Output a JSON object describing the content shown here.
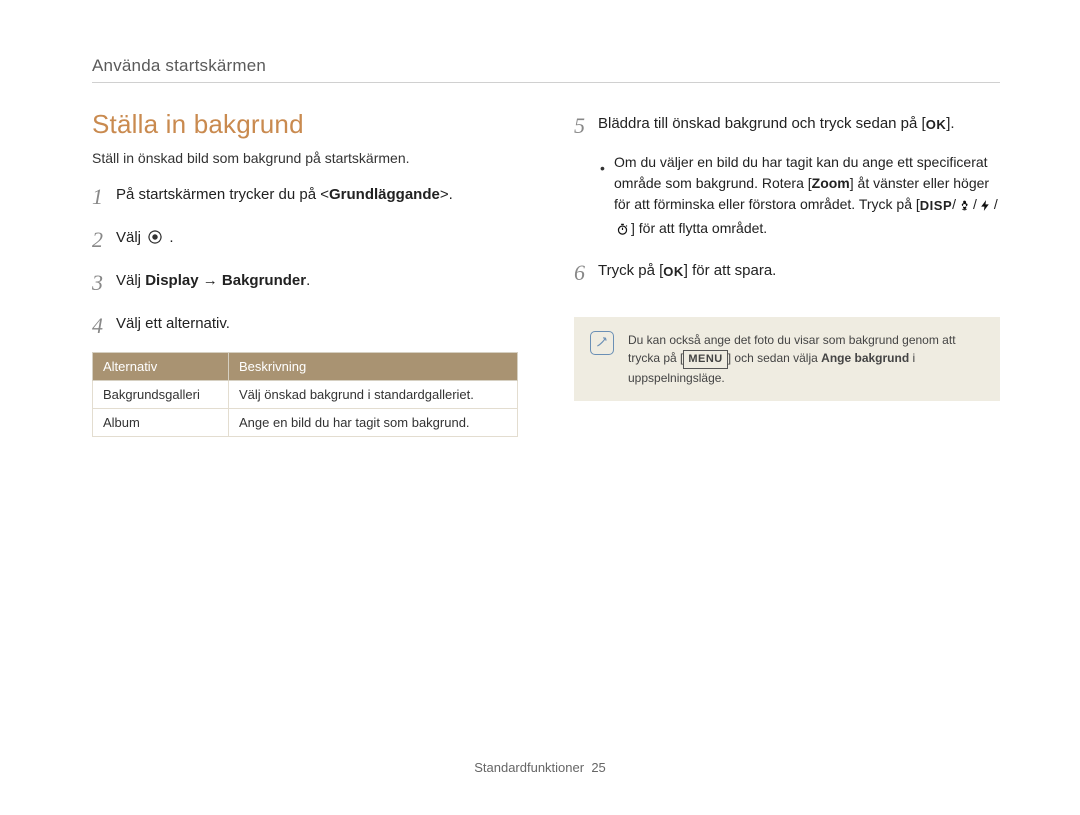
{
  "header": {
    "breadcrumb": "Använda startskärmen"
  },
  "left": {
    "title": "Ställa in bakgrund",
    "intro": "Ställ in önskad bild som bakgrund på startskärmen.",
    "step1_pre": "På startskärmen trycker du på <",
    "step1_bold": "Grundläggande",
    "step1_post": ">.",
    "step2_pre": "Välj ",
    "step2_post": ".",
    "step3_pre": "Välj ",
    "step3_bold1": "Display",
    "step3_arrow": " → ",
    "step3_bold2": "Bakgrunder",
    "step3_post": ".",
    "step4": "Välj ett alternativ.",
    "table": {
      "h1": "Alternativ",
      "h2": "Beskrivning",
      "r1c1": "Bakgrundsgalleri",
      "r1c2": "Välj önskad bakgrund i standardgalleriet.",
      "r2c1": "Album",
      "r2c2": "Ange en bild du har tagit som bakgrund."
    }
  },
  "right": {
    "step5_pre": "Bläddra till önskad bakgrund och tryck sedan på [",
    "step5_ok": "OK",
    "step5_post": "].",
    "bullet_a": "Om du väljer en bild du har tagit kan du ange ett specificerat område som bakgrund. Rotera [",
    "bullet_zoom": "Zoom",
    "bullet_b": "] åt vänster eller höger för att förminska eller förstora området. Tryck på [",
    "bullet_disp": "DISP",
    "bullet_c": "/",
    "bullet_d": "/",
    "bullet_e": "/",
    "bullet_f": "] för att flytta området.",
    "step6_pre": "Tryck på [",
    "step6_ok": "OK",
    "step6_post": "] för att spara.",
    "note_a": "Du kan också ange det foto du visar som bakgrund genom att trycka på [",
    "note_menu": "MENU",
    "note_b": "] och sedan välja ",
    "note_bold": "Ange bakgrund",
    "note_c": " i uppspelningsläge."
  },
  "footer": {
    "label": "Standardfunktioner",
    "page": "25"
  }
}
